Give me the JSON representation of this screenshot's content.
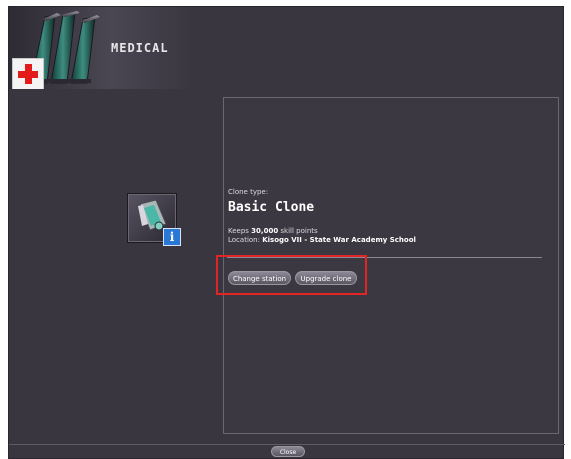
{
  "header": {
    "title": "MEDICAL",
    "icon": "medical-cross-icon"
  },
  "clone": {
    "type_label": "Clone type:",
    "name": "Basic Clone",
    "keeps_prefix": "Keeps ",
    "skill_points": "30,000",
    "keeps_suffix": " skill points",
    "location_prefix": "Location: ",
    "location": "Kisogo VII - State War Academy School",
    "icon": "clone-icon",
    "info_icon": "i"
  },
  "actions": {
    "change_station": "Change station",
    "upgrade_clone": "Upgrade clone"
  },
  "footer": {
    "close": "Close"
  },
  "colors": {
    "window_bg": "#3a3640",
    "highlight": "#e12424",
    "medical_red": "#e21b1b",
    "info_blue": "#2a78d6"
  }
}
